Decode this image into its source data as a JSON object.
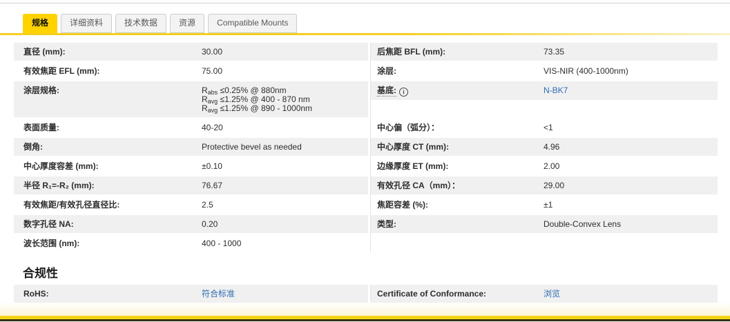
{
  "colors": {
    "brand_yellow": "#ffd200",
    "underline_yellow": "#f5cf1b",
    "link_blue": "#2d6cb2",
    "row_gray": "#f0f0f0",
    "footer_yellow": "#f2d414",
    "footer_dark": "#332f12"
  },
  "tabs": [
    {
      "id": "specs",
      "label": "规格",
      "active": true
    },
    {
      "id": "details",
      "label": "详细资料",
      "active": false
    },
    {
      "id": "tech-data",
      "label": "技术数据",
      "active": false
    },
    {
      "id": "resources",
      "label": "资源",
      "active": false
    },
    {
      "id": "compatible-mounts",
      "label": "Compatible Mounts",
      "active": false
    }
  ],
  "spec_table": {
    "rows": [
      {
        "left": {
          "label": "直径 (mm):",
          "value": "30.00"
        },
        "right": {
          "label": "后焦距 BFL (mm):",
          "value": "73.35"
        }
      },
      {
        "left": {
          "label": "有效焦距 EFL (mm):",
          "value": "75.00"
        },
        "right": {
          "label": "涂层:",
          "value": "VIS-NIR (400-1000nm)"
        }
      },
      {
        "left": {
          "label": "涂层规格:",
          "value_lines": [
            [
              {
                "t": "R"
              },
              {
                "t": "abs",
                "sub": true
              },
              {
                "t": " ≤0.25% @ 880nm"
              }
            ],
            [
              {
                "t": "R"
              },
              {
                "t": "avg",
                "sub": true
              },
              {
                "t": " ≤1.25% @ 400 - 870 nm"
              }
            ],
            [
              {
                "t": "R"
              },
              {
                "t": "avg",
                "sub": true
              },
              {
                "t": " ≤1.25% @ 890 - 1000nm"
              }
            ]
          ]
        },
        "right": {
          "label": "基底:",
          "info": true,
          "value": "N-BK7",
          "link": true
        }
      },
      {
        "left": {
          "label": "表面质量:",
          "value": "40-20"
        },
        "right": {
          "label": "中心偏（弧分）：",
          "value": "<1"
        }
      },
      {
        "left": {
          "label": "倒角:",
          "value": "Protective bevel as needed"
        },
        "right": {
          "label": "中心厚度 CT (mm):",
          "value": "4.96"
        }
      },
      {
        "left": {
          "label": "中心厚度容差 (mm):",
          "value": "±0.10"
        },
        "right": {
          "label": "边缘厚度 ET (mm):",
          "value": "2.00"
        }
      },
      {
        "left": {
          "label": "半径 R₁=-R₂ (mm):",
          "value": "76.67"
        },
        "right": {
          "label": "有效孔径 CA（mm）：",
          "value": "29.00"
        }
      },
      {
        "left": {
          "label": "有效焦距/有效孔径直径比:",
          "value": "2.5"
        },
        "right": {
          "label": "焦距容差 (%):",
          "value": "±1"
        }
      },
      {
        "left": {
          "label": "数字孔径 NA:",
          "value": "0.20"
        },
        "right": {
          "label": "类型:",
          "value": "Double-Convex Lens"
        }
      },
      {
        "left": {
          "label": "波长范围 (nm):",
          "value": "400 - 1000"
        },
        "right": null
      }
    ]
  },
  "compliance": {
    "heading": "合规性",
    "rows": [
      {
        "left": {
          "label": "RoHS:",
          "value": "符合标准",
          "link": true
        },
        "right": {
          "label": "Certificate of Conformance:",
          "value": "浏览",
          "link": true
        }
      }
    ]
  }
}
